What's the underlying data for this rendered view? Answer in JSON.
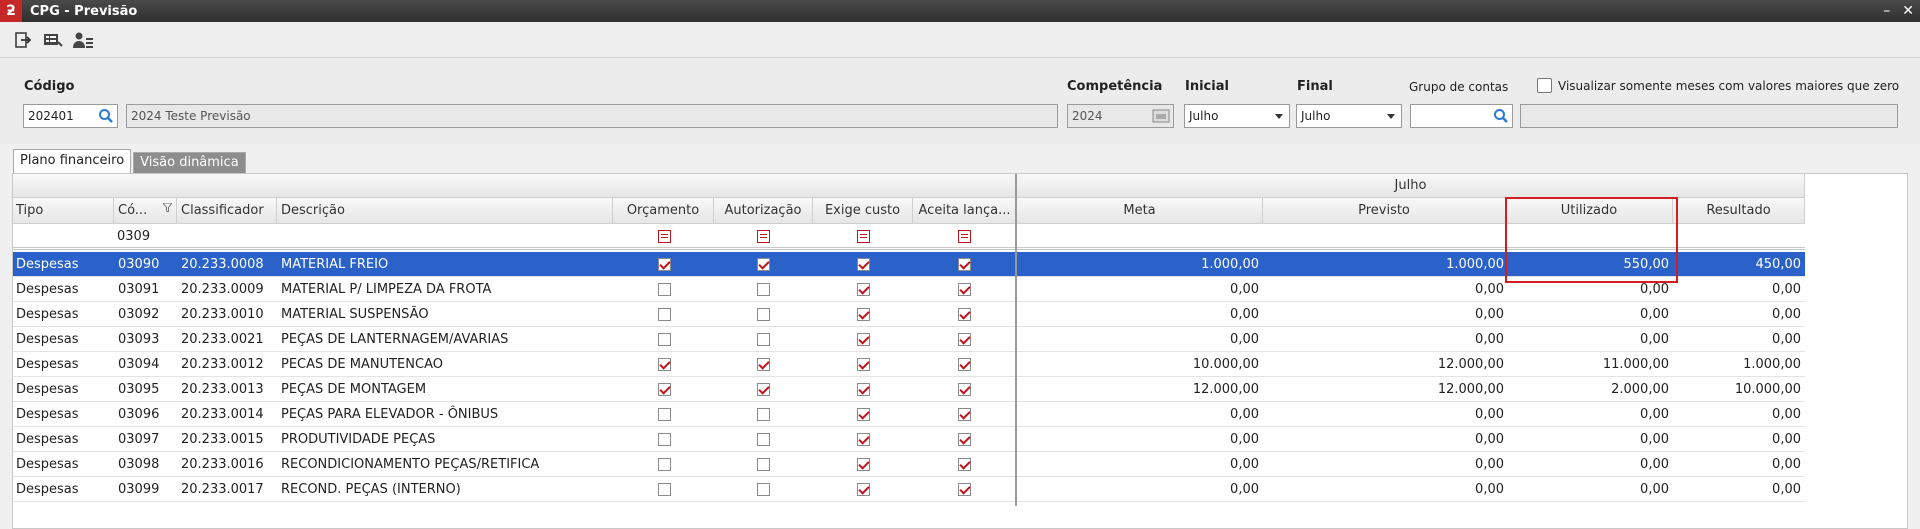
{
  "window": {
    "title": "CPG - Previsão",
    "app_icon": "ƻ",
    "minimize": "–",
    "close": "✕"
  },
  "toolbar": {
    "icons": [
      "exit-icon",
      "list-icon",
      "user-icon"
    ]
  },
  "form": {
    "codigo_label": "Código",
    "codigo_value": "202401",
    "descricao_value": "2024 Teste Previsão",
    "competencia_label": "Competência",
    "competencia_value": "2024",
    "inicial_label": "Inicial",
    "inicial_value": "Julho",
    "final_label": "Final",
    "final_value": "Julho",
    "grupo_label": "Grupo de contas",
    "grupo_value": "",
    "visualizar_label": "Visualizar somente meses com valores maiores que zero",
    "extra_value": ""
  },
  "tabs": [
    {
      "label": "Plano financeiro",
      "active": true
    },
    {
      "label": "Visão dinâmica",
      "active": false
    }
  ],
  "grid": {
    "band_label": "Julho",
    "columns": {
      "tipo": "Tipo",
      "codigo": "Có...",
      "classificador": "Classificador",
      "descricao": "Descrição",
      "orcamento": "Orçamento",
      "autorizacao": "Autorização",
      "exige_custo": "Exige custo",
      "aceita": "Aceita lança...",
      "meta": "Meta",
      "previsto": "Previsto",
      "utilizado": "Utilizado",
      "resultado": "Resultado"
    },
    "filter_row": {
      "codigo": "0309"
    },
    "rows": [
      {
        "tipo": "Despesas",
        "codigo": "03090",
        "classificador": "20.233.0008",
        "descricao": "MATERIAL FREIO",
        "orcamento": true,
        "autorizacao": true,
        "exige": true,
        "aceita": true,
        "meta": "1.000,00",
        "previsto": "1.000,00",
        "utilizado": "550,00",
        "resultado": "450,00",
        "selected": true
      },
      {
        "tipo": "Despesas",
        "codigo": "03091",
        "classificador": "20.233.0009",
        "descricao": "MATERIAL P/ LIMPEZA DA FROTA",
        "orcamento": false,
        "autorizacao": false,
        "exige": true,
        "aceita": true,
        "meta": "0,00",
        "previsto": "0,00",
        "utilizado": "0,00",
        "resultado": "0,00",
        "selected": false
      },
      {
        "tipo": "Despesas",
        "codigo": "03092",
        "classificador": "20.233.0010",
        "descricao": "MATERIAL SUSPENSÃO",
        "orcamento": false,
        "autorizacao": false,
        "exige": true,
        "aceita": true,
        "meta": "0,00",
        "previsto": "0,00",
        "utilizado": "0,00",
        "resultado": "0,00",
        "selected": false
      },
      {
        "tipo": "Despesas",
        "codigo": "03093",
        "classificador": "20.233.0021",
        "descricao": "PEÇAS DE LANTERNAGEM/AVARIAS",
        "orcamento": false,
        "autorizacao": false,
        "exige": true,
        "aceita": true,
        "meta": "0,00",
        "previsto": "0,00",
        "utilizado": "0,00",
        "resultado": "0,00",
        "selected": false
      },
      {
        "tipo": "Despesas",
        "codigo": "03094",
        "classificador": "20.233.0012",
        "descricao": "PECAS DE MANUTENCAO",
        "orcamento": true,
        "autorizacao": true,
        "exige": true,
        "aceita": true,
        "meta": "10.000,00",
        "previsto": "12.000,00",
        "utilizado": "11.000,00",
        "resultado": "1.000,00",
        "selected": false
      },
      {
        "tipo": "Despesas",
        "codigo": "03095",
        "classificador": "20.233.0013",
        "descricao": "PEÇAS DE MONTAGEM",
        "orcamento": true,
        "autorizacao": true,
        "exige": true,
        "aceita": true,
        "meta": "12.000,00",
        "previsto": "12.000,00",
        "utilizado": "2.000,00",
        "resultado": "10.000,00",
        "selected": false
      },
      {
        "tipo": "Despesas",
        "codigo": "03096",
        "classificador": "20.233.0014",
        "descricao": "PEÇAS PARA ELEVADOR - ÔNIBUS",
        "orcamento": false,
        "autorizacao": false,
        "exige": true,
        "aceita": true,
        "meta": "0,00",
        "previsto": "0,00",
        "utilizado": "0,00",
        "resultado": "0,00",
        "selected": false
      },
      {
        "tipo": "Despesas",
        "codigo": "03097",
        "classificador": "20.233.0015",
        "descricao": "PRODUTIVIDADE PEÇAS",
        "orcamento": false,
        "autorizacao": false,
        "exige": true,
        "aceita": true,
        "meta": "0,00",
        "previsto": "0,00",
        "utilizado": "0,00",
        "resultado": "0,00",
        "selected": false
      },
      {
        "tipo": "Despesas",
        "codigo": "03098",
        "classificador": "20.233.0016",
        "descricao": "RECONDICIONAMENTO PEÇAS/RETIFICA",
        "orcamento": false,
        "autorizacao": false,
        "exige": true,
        "aceita": true,
        "meta": "0,00",
        "previsto": "0,00",
        "utilizado": "0,00",
        "resultado": "0,00",
        "selected": false
      },
      {
        "tipo": "Despesas",
        "codigo": "03099",
        "classificador": "20.233.0017",
        "descricao": "RECOND. PEÇAS (INTERNO)",
        "orcamento": false,
        "autorizacao": false,
        "exige": true,
        "aceita": true,
        "meta": "0,00",
        "previsto": "0,00",
        "utilizado": "0,00",
        "resultado": "0,00",
        "selected": false
      }
    ]
  },
  "colors": {
    "selection": "#2a62c9",
    "check": "#c0141c",
    "highlight_box": "#d11f1f",
    "titlebar": "#3a3a3a"
  }
}
